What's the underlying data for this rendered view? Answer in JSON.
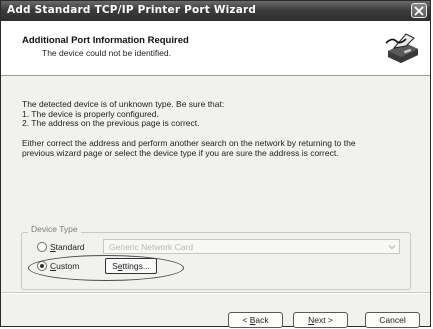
{
  "window": {
    "title": "Add Standard TCP/IP Printer Port Wizard",
    "close_icon": "close-icon"
  },
  "header": {
    "title": "Additional Port Information Required",
    "subtitle": "The device could not be identified.",
    "icon": "printer-cable-icon"
  },
  "body": {
    "line1": "The detected device is of unknown type.  Be sure that:",
    "line2": "1. The device is properly configured.",
    "line3": "2.  The address on the previous page is correct.",
    "line4": "Either correct the address and perform another search on the network by returning to the",
    "line5": "previous wizard page or select the device type if you are sure the address is correct."
  },
  "device_type": {
    "legend": "Device Type",
    "standard": {
      "pre": "",
      "accel": "S",
      "post": "tandard",
      "selected": false
    },
    "standard_value": "Generic Network Card",
    "custom": {
      "pre": "",
      "accel": "C",
      "post": "ustom",
      "selected": true
    },
    "settings": {
      "pre": "S",
      "accel": "e",
      "post": "ttings..."
    }
  },
  "buttons": {
    "back": {
      "pre": "< ",
      "accel": "B",
      "post": "ack"
    },
    "next": {
      "pre": "",
      "accel": "N",
      "post": "ext >"
    },
    "cancel": "Cancel"
  },
  "colors": {
    "titlebar": "#3c3c3c",
    "body_background": "#f1f1ed",
    "disabled_text": "#b9b9b3"
  }
}
